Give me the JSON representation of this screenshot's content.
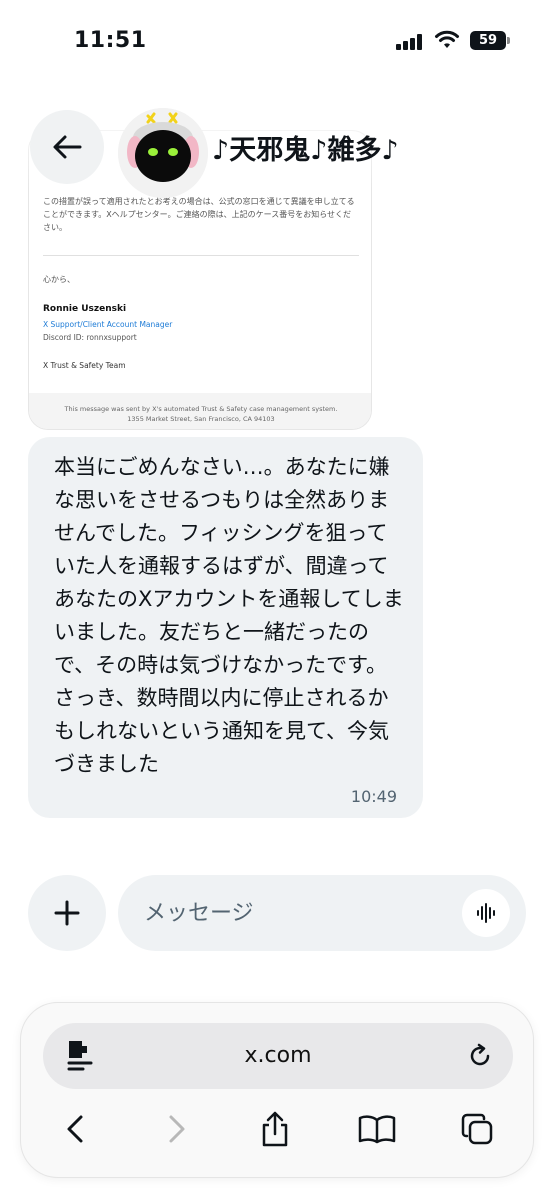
{
  "status_bar": {
    "time": "11:51",
    "battery": "59"
  },
  "header": {
    "title": "♪天邪鬼♪雑多♪"
  },
  "attachment": {
    "notice": "この措置が誤って適用されたとお考えの場合は、公式の窓口を通じて異議を申し立てることができます。Xヘルプセンター。ご連絡の際は、上記のケース番号をお知らせください。",
    "closing": "心から、",
    "name": "Ronnie Uszenski",
    "role": "X Support/Client Account Manager",
    "discord": "Discord ID: ronnxsupport",
    "team": "X Trust & Safety Team",
    "footer_line1": "This message was sent by X's automated Trust & Safety case management system.",
    "footer_line2": "1355 Market Street, San Francisco, CA 94103"
  },
  "message": {
    "text": "本当にごめんなさい…。あなたに嫌な思いをさせるつもりは全然ありませんでした。フィッシングを狙っていた人を通報するはずが、間違ってあなたのXアカウントを通報してしまいました。友だちと一緒だったので、その時は気づけなかったです。さっき、数時間以内に停止されるかもしれないという通知を見て、今気づきました",
    "time": "10:49"
  },
  "composer": {
    "placeholder": "メッセージ"
  },
  "browser": {
    "url": "x.com"
  },
  "icons": {
    "back": "arrow-left-icon",
    "plus": "plus-icon",
    "voice": "waveform-icon",
    "page": "page-menu-icon",
    "reload": "reload-icon",
    "nav_back": "chevron-left-icon",
    "nav_forward": "chevron-right-icon",
    "share": "share-icon",
    "bookmarks": "book-icon",
    "tabs": "tabs-icon"
  },
  "colors": {
    "bubble": "#eff2f4",
    "secondary_text": "#536471",
    "link_blue": "#1d7bd6"
  }
}
